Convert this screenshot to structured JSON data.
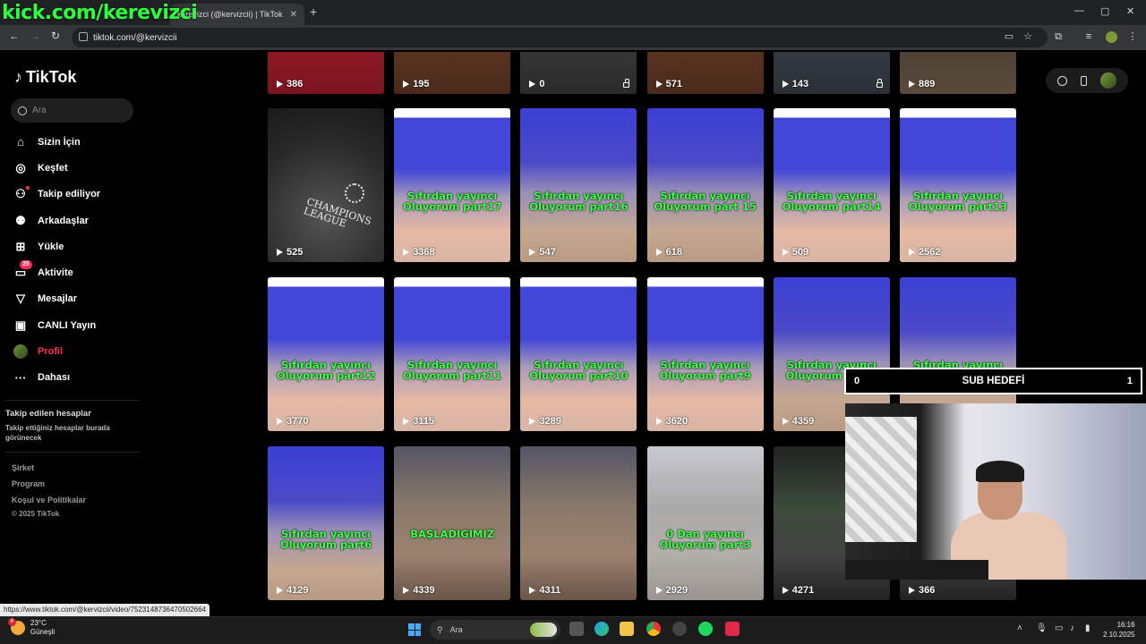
{
  "overlay_title": "kick.com/kerevizci",
  "browser": {
    "tab_title": "kerevizci (@kervizcii) | TikTok",
    "tab_close": "✕",
    "new_tab": "+",
    "url": "tiktok.com/@kervizcii",
    "window_controls": [
      "—",
      "▢",
      "✕"
    ]
  },
  "sidebar": {
    "logo": "TikTok",
    "search_placeholder": "Ara",
    "items": [
      {
        "label": "Sizin İçin",
        "icon": "home-icon"
      },
      {
        "label": "Keşfet",
        "icon": "compass-icon"
      },
      {
        "label": "Takip ediliyor",
        "icon": "following-icon"
      },
      {
        "label": "Arkadaşlar",
        "icon": "friends-icon"
      },
      {
        "label": "Yükle",
        "icon": "upload-icon"
      },
      {
        "label": "Aktivite",
        "icon": "activity-icon",
        "badge": "25"
      },
      {
        "label": "Mesajlar",
        "icon": "messages-icon"
      },
      {
        "label": "CANLI Yayın",
        "icon": "live-icon"
      },
      {
        "label": "Profil",
        "icon": "profile-avatar"
      },
      {
        "label": "Dahası",
        "icon": "more-icon"
      }
    ],
    "followed_header": "Takip edilen hesaplar",
    "followed_sub": "Takip ettiğiniz hesaplar burada görünecek",
    "footer": [
      "Şirket",
      "Program",
      "Koşul ve Politikalar",
      "© 2025 TikTok"
    ]
  },
  "videos": [
    {
      "views": "386",
      "caption": "",
      "style": "bg-red"
    },
    {
      "views": "195",
      "caption": "",
      "style": "bg-brown"
    },
    {
      "views": "0",
      "caption": "",
      "style": "bg-dark",
      "locked": true
    },
    {
      "views": "571",
      "caption": "",
      "style": "bg-brown"
    },
    {
      "views": "143",
      "caption": "",
      "style": "bg-car",
      "locked": true
    },
    {
      "views": "889",
      "caption": "",
      "style": "bg-man"
    },
    {
      "views": "525",
      "caption": "",
      "style": "bg-cl",
      "special": "champions"
    },
    {
      "views": "3368",
      "caption": "Sıfırdan yayıncı Oluyorum part17",
      "style": "bg-room2"
    },
    {
      "views": "547",
      "caption": "Sıfırdan yayıncı Oluyorum part16",
      "style": "bg-room"
    },
    {
      "views": "618",
      "caption": "Sıfırdan yayıncı Oluyorum part 15",
      "style": "bg-room"
    },
    {
      "views": "509",
      "caption": "Sıfırdan yayıncı Oluyorum part14",
      "style": "bg-room2"
    },
    {
      "views": "2562",
      "caption": "Sıfırdan yayıncı Oluyorum part13",
      "style": "bg-room2"
    },
    {
      "views": "3770",
      "caption": "Sıfırdan yayıncı Oluyorum part12",
      "style": "bg-room2"
    },
    {
      "views": "3115",
      "caption": "Sıfırdan yayıncı Oluyorum part11",
      "style": "bg-room2"
    },
    {
      "views": "3289",
      "caption": "Sıfırdan yayıncı Oluyorum part10",
      "style": "bg-room2"
    },
    {
      "views": "3620",
      "caption": "Sıfırdan yayıncı Oluyorum part9",
      "style": "bg-room2"
    },
    {
      "views": "4359",
      "caption": "Sıfırdan yayıncı Oluyorum part8",
      "style": "bg-room"
    },
    {
      "views": "",
      "caption": "Sıfırdan yayıncı Oluyorum part7",
      "style": "bg-room"
    },
    {
      "views": "4129",
      "caption": "Sıfırdan yayıncı Oluyorum part6",
      "style": "bg-room"
    },
    {
      "views": "4339",
      "caption": "BAŞLADIGIMIZ",
      "style": "bg-game"
    },
    {
      "views": "4311",
      "caption": "",
      "style": "bg-game"
    },
    {
      "views": "2929",
      "caption": "0 Dan yayıncı Oluyorum part3",
      "style": "bg-game2"
    },
    {
      "views": "4271",
      "caption": "",
      "style": "bg-desk"
    },
    {
      "views": "366",
      "caption": "",
      "style": "bg-desk"
    }
  ],
  "champions_text": "CHAMPIONS LEAGUE",
  "sub_goal": {
    "left": "0",
    "label": "SUB HEDEFİ",
    "right": "1"
  },
  "status_url": "https://www.tiktok.com/@kervizcii/video/7523148736470502664",
  "taskbar": {
    "temp": "23°C",
    "weather": "Güneşli",
    "weather_badge": "6",
    "search": "Ara",
    "time": "16:16",
    "date": "2.10.2025"
  },
  "colors": {
    "accent": "#fe2c55",
    "caption_green": "#3cff47"
  }
}
